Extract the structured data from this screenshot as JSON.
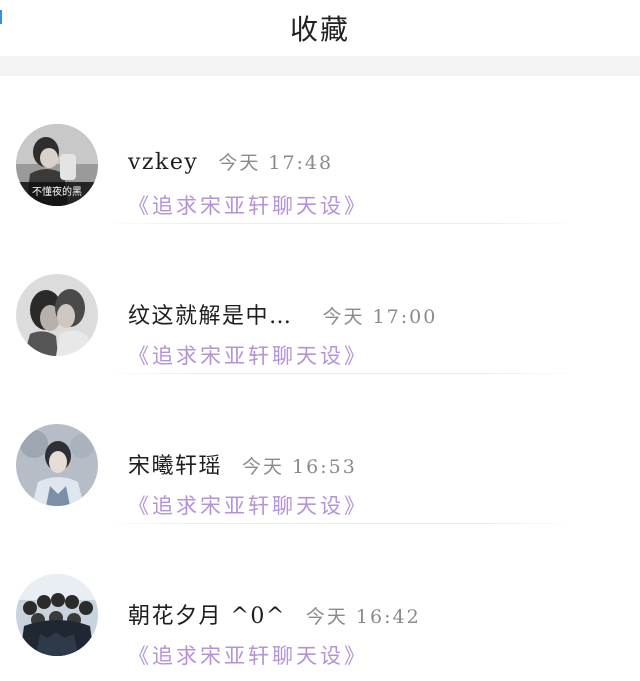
{
  "header": {
    "title": "收藏"
  },
  "favorites": [
    {
      "sender": "vzkey",
      "time": "今天 17:48",
      "message": "《追求宋亚轩聊天设》",
      "avatar_overlay_text": "不懂夜的黑"
    },
    {
      "sender": "纹这就解是中…",
      "time": "今天 17:00",
      "message": "《追求宋亚轩聊天设》"
    },
    {
      "sender": "宋曦轩瑶",
      "time": "今天 16:53",
      "message": "《追求宋亚轩聊天设》"
    },
    {
      "sender": "朝花夕月 ^0^",
      "time": "今天 16:42",
      "message": "《追求宋亚轩聊天设》"
    }
  ],
  "colors": {
    "message_purple": "#b493d6",
    "time_gray": "#8a8a8a",
    "band_gray": "#f4f4f4"
  }
}
